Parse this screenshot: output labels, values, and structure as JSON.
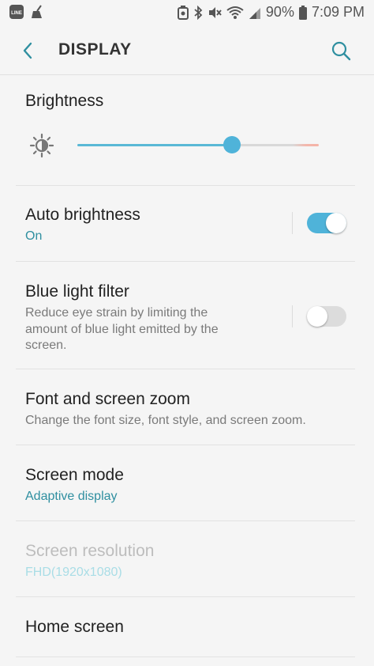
{
  "status_bar": {
    "battery_percent": "90%",
    "time": "7:09 PM",
    "left_icons": [
      "line-app-icon",
      "broom-icon"
    ],
    "right_icons": [
      "battery-saver-icon",
      "bluetooth-icon",
      "mute-icon",
      "wifi-icon",
      "signal-icon",
      "battery-icon"
    ]
  },
  "app_bar": {
    "title": "DISPLAY",
    "back_icon": "chevron-left-icon",
    "search_icon": "search-icon",
    "accent": "#2f8fa0"
  },
  "brightness": {
    "title": "Brightness",
    "level_percent": 63,
    "icon": "brightness-icon"
  },
  "auto_brightness": {
    "title": "Auto brightness",
    "status": "On",
    "enabled": true
  },
  "blue_light_filter": {
    "title": "Blue light filter",
    "description": "Reduce eye strain by limiting the amount of blue light emitted by the screen.",
    "enabled": false
  },
  "font_zoom": {
    "title": "Font and screen zoom",
    "description": "Change the font size, font style, and screen zoom."
  },
  "screen_mode": {
    "title": "Screen mode",
    "value": "Adaptive display"
  },
  "screen_resolution": {
    "title": "Screen resolution",
    "value": "FHD(1920x1080)",
    "disabled": true
  },
  "home_screen": {
    "title": "Home screen"
  }
}
